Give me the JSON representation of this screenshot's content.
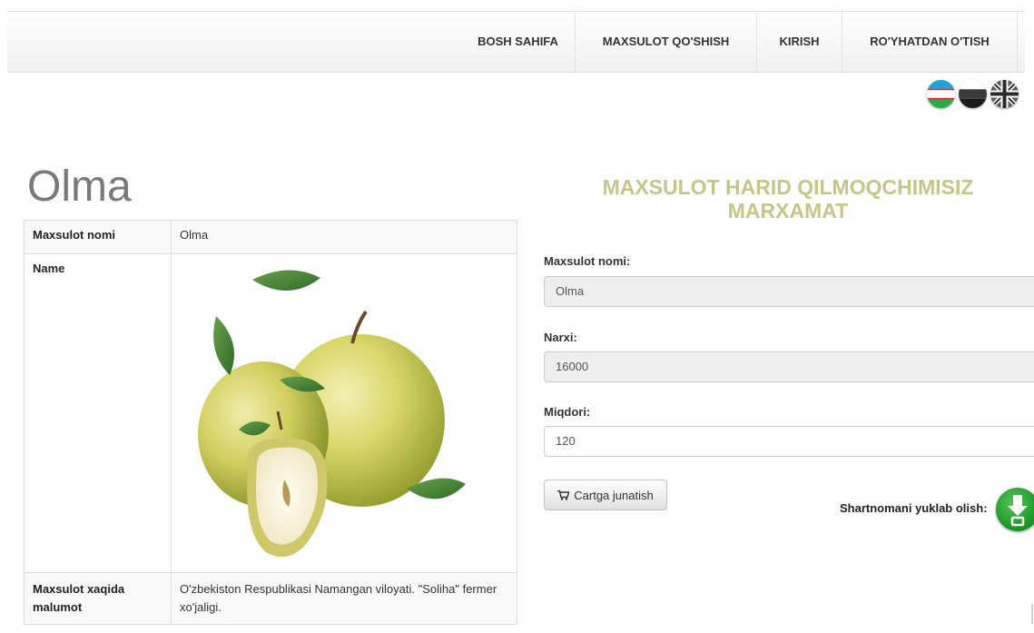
{
  "nav": {
    "home": "BOSH SAHIFA",
    "add_product": "MAXSULOT QO'SHISH",
    "login": "KIRISH",
    "register": "RO'YHATDAN O'TISH"
  },
  "languages": [
    "uz-flag-icon",
    "ru-flag-icon",
    "uk-flag-icon"
  ],
  "product": {
    "title": "Olma",
    "rows": [
      {
        "key": "Maxsulot nomi",
        "value": "Olma"
      },
      {
        "key": "Name",
        "value": ""
      },
      {
        "key": "Maxsulot xaqida malumot",
        "value": "O'zbekiston Respublikasi Namangan viloyati. \"Soliha\" fermer xo'jaligi."
      }
    ]
  },
  "order": {
    "heading": "MAXSULOT HARID QILMOQCHIMISIZ MARXAMAT",
    "name_label": "Maxsulot nomi:",
    "name_value": "Olma",
    "price_label": "Narxi:",
    "price_value": "16000",
    "qty_label": "Miqdori:",
    "qty_value": "120",
    "cart_button": "Cartga junatish",
    "download_label": "Shartnomani yuklab olish:"
  },
  "colors": {
    "heading": "#c7c58a",
    "title": "#7a7a7a",
    "download_green": "#1f9a2a"
  }
}
